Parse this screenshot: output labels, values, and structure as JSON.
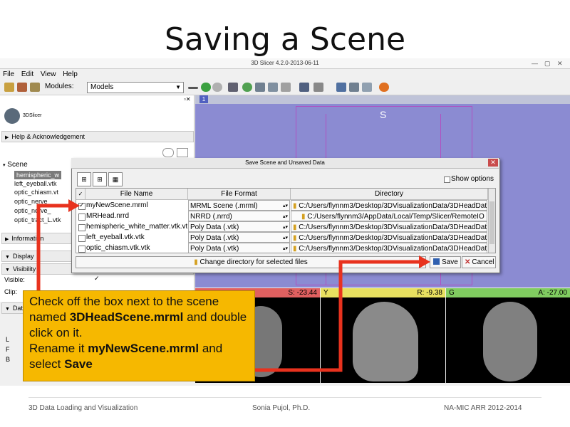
{
  "slide": {
    "title": "Saving a Scene",
    "footer_left": "3D Data Loading and Visualization",
    "footer_center": "Sonia Pujol, Ph.D.",
    "footer_right": "NA-MIC ARR 2012-2014"
  },
  "window": {
    "title": "3D Slicer 4.2.0-2013-06-11",
    "menu": [
      "File",
      "Edit",
      "View",
      "Help"
    ],
    "modules_label": "Modules:",
    "module_selected": "Models"
  },
  "left_panel": {
    "logo_text": "3DSlicer",
    "help_section": "Help & Acknowledgement",
    "scene_label": "Scene",
    "scene_items": [
      "hemispheric_w",
      "left_eyeball.vtk",
      "optic_chiasm.vt",
      "optic_nerve_",
      "optic_nerve_",
      "optic_tract_L.vtk"
    ],
    "information_section": "Information",
    "display_section": "Display",
    "visibility_section": "Visibility",
    "visible_label": "Visible:",
    "clip_label": "Clip:",
    "data_section": "Dat",
    "side_letters": [
      "L",
      "F",
      "B"
    ]
  },
  "view3d": {
    "orientation_label": "S",
    "view_tag": "1"
  },
  "slices": {
    "red": {
      "value": "S: -23.44"
    },
    "yellow": {
      "tag": "Y",
      "value": "R: -9.38"
    },
    "green": {
      "tag": "G",
      "value": "A: -27.00"
    }
  },
  "dialog": {
    "title": "Save Scene and Unsaved Data",
    "show_options": "Show options",
    "columns": [
      "File Name",
      "File Format",
      "Directory"
    ],
    "rows": [
      {
        "checked": true,
        "name": "myNewScene.mrml",
        "format": "MRML Scene (.mrml)",
        "directory": "C:/Users/flynnm3/Desktop/3DVisualizationData/3DHeadDat"
      },
      {
        "checked": false,
        "name": "MRHead.nrrd",
        "format": "NRRD (.nrrd)",
        "directory": "C:/Users/flynnm3/AppData/Local/Temp/Slicer/RemoteIO"
      },
      {
        "checked": false,
        "name": "hemispheric_white_matter.vtk.vtk",
        "format": "Poly Data (.vtk)",
        "directory": "C:/Users/flynnm3/Desktop/3DVisualizationData/3DHeadDat"
      },
      {
        "checked": false,
        "name": "left_eyeball.vtk.vtk",
        "format": "Poly Data (.vtk)",
        "directory": "C:/Users/flynnm3/Desktop/3DVisualizationData/3DHeadDat"
      },
      {
        "checked": false,
        "name": "optic_chiasm.vtk.vtk",
        "format": "Poly Data (.vtk)",
        "directory": "C:/Users/flynnm3/Desktop/3DVisualizationData/3DHeadDat"
      }
    ],
    "change_dir": "Change directory for selected files",
    "save": "Save",
    "cancel": "Cancel"
  },
  "callout": {
    "line1": "Check off the box next to the scene named ",
    "bold1": "3DHeadScene.mrml",
    "line2": " and double click on it.",
    "line3": "Rename it ",
    "bold2": "myNewScene.mrml",
    "line4": " and select ",
    "bold3": "Save"
  },
  "colors": {
    "callout_bg": "#f6b800",
    "arrow": "#e8321e",
    "view3d_bg": "#8b8bd2",
    "red_slice": "#e06060",
    "yellow_slice": "#e8e060",
    "green_slice": "#80cc60"
  }
}
